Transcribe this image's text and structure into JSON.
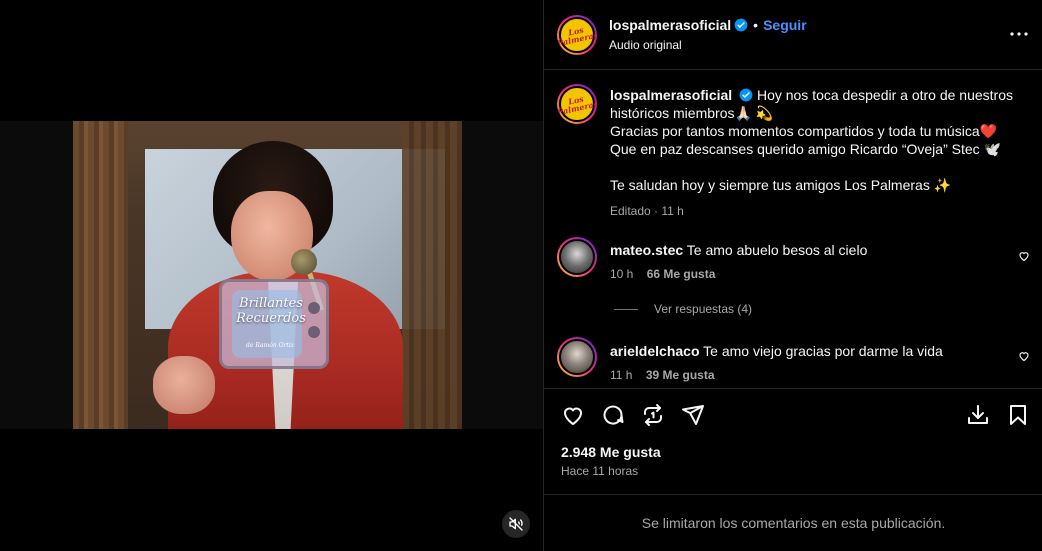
{
  "post": {
    "username": "lospalmerasoficial",
    "follow_label": "Seguir",
    "dot": "•",
    "audio": "Audio original",
    "more_icon": "more-horizontal-icon",
    "logo_text": "Los Palmeras"
  },
  "video": {
    "overlay_title": "Brillantes Recuerdos",
    "overlay_sub": "de Ramón Ortiz",
    "mute_icon": "speaker-muted-icon"
  },
  "caption": {
    "username": "lospalmerasoficial",
    "line1": "Hoy nos toca despedir a otro de nuestros históricos miembros🙏🏻 💫",
    "line2": "Gracias por tantos momentos compartidos y toda tu música❤️",
    "line3": "Que en paz descanses querido amigo Ricardo “Oveja” Stec 🕊️",
    "line4": "Te saludan hoy y siempre tus amigos Los Palmeras ✨",
    "edited": "Editado · 11 h"
  },
  "comments": [
    {
      "username": "mateo.stec",
      "text": "Te amo abuelo besos al cielo",
      "time": "10 h",
      "likes": "66 Me gusta"
    },
    {
      "username": "arieldelchaco",
      "text": "Te amo viejo gracias por darme la vida",
      "time": "11 h",
      "likes": "39 Me gusta"
    }
  ],
  "view_replies": "Ver respuestas (4)",
  "actions": {
    "like_icon": "heart-icon",
    "comment_icon": "comment-icon",
    "repost_icon": "repost-icon",
    "share_icon": "send-icon",
    "download_icon": "download-icon",
    "save_icon": "bookmark-icon"
  },
  "stats": {
    "likes": "2.948 Me gusta",
    "time_ago": "Hace 11 horas"
  },
  "footer": {
    "notice": "Se limitaron los comentarios en esta publicación."
  },
  "colors": {
    "background": "#000000",
    "link_blue": "#4a90ff",
    "muted_text": "#a8a8a8",
    "verified_blue": "#0095f6"
  }
}
